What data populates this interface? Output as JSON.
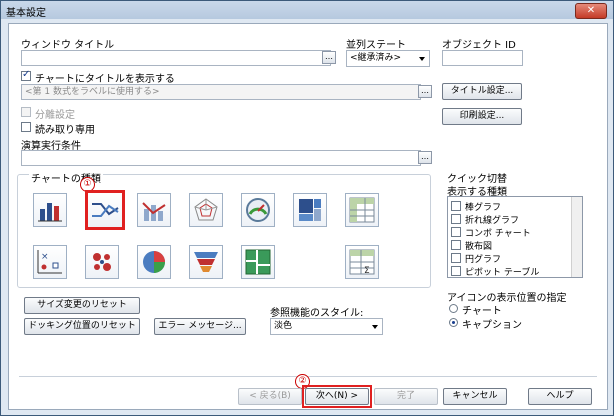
{
  "window": {
    "title": "基本設定",
    "close_glyph": "✕"
  },
  "fields": {
    "window_title_label": "ウィンドウ タイトル",
    "alternate_state_label": "並列ステート",
    "alternate_state_value": "<継承済み>",
    "object_id_label": "オブジェクト ID",
    "show_title_label": "チャートにタイトルを表示する",
    "title_placeholder": "<第 1 数式をラベルに使用する>",
    "title_settings_button": "タイトル設定...",
    "print_settings_button": "印刷設定...",
    "detach_label": "分離設定",
    "readonly_label": "読み取り専用",
    "calc_condition_label": "演算実行条件"
  },
  "chart_types": {
    "label": "チャートの種類",
    "tiles": [
      "bar-chart-icon",
      "line-chart-icon",
      "combo-chart-icon",
      "radar-chart-icon",
      "gauge-chart-icon",
      "block-chart-icon",
      "pivot-table-icon",
      "scatter-chart-icon",
      "grid-chart-icon",
      "pie-chart-icon",
      "funnel-chart-icon",
      "mekko-chart-icon",
      "straight-table-icon"
    ]
  },
  "quick_switch": {
    "label": "クイック切替",
    "types_label": "表示する種類",
    "items": [
      "棒グラフ",
      "折れ線グラフ",
      "コンボ チャート",
      "散布図",
      "円グラフ",
      "ピボット テーブル"
    ],
    "icon_position_label": "アイコンの表示位置の指定",
    "radio_chart": "チャート",
    "radio_caption": "キャプション"
  },
  "buttons": {
    "reset_size": "サイズ変更のリセット",
    "reset_docking": "ドッキング位置のリセット",
    "error_message": "エラー メッセージ...",
    "back": "< 戻る(B)",
    "next": "次へ(N) >",
    "finish": "完了",
    "cancel": "キャンセル",
    "help": "ヘルプ"
  },
  "reference_style": {
    "label": "参照機能のスタイル:",
    "value": "淡色"
  },
  "annotations": {
    "mark1": "①",
    "mark2": "②"
  },
  "colors": {
    "highlight": "#e02020"
  }
}
